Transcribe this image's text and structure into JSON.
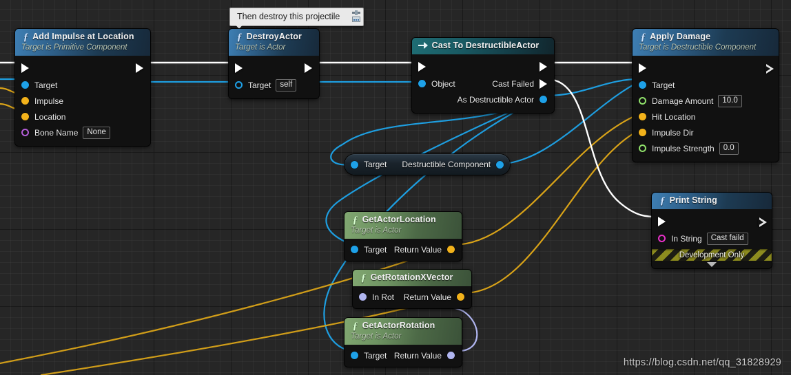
{
  "watermark": "https://blog.csdn.net/qq_31828929",
  "tooltip": {
    "text": "Then destroy this projectile"
  },
  "nodes": {
    "add_impulse": {
      "title": "Add Impulse at Location",
      "subtitle": "Target is Primitive Component",
      "pins": [
        {
          "label": "Target"
        },
        {
          "label": "Impulse"
        },
        {
          "label": "Location"
        },
        {
          "label": "Bone Name",
          "value": "None"
        }
      ]
    },
    "destroy_actor": {
      "title": "DestroyActor",
      "subtitle": "Target is Actor",
      "pins": [
        {
          "label": "Target",
          "value": "self"
        }
      ]
    },
    "cast": {
      "title": "Cast To DestructibleActor",
      "input_pin": "Object",
      "out_failed": "Cast Failed",
      "out_as": "As Destructible Actor"
    },
    "apply_damage": {
      "title": "Apply Damage",
      "subtitle": "Target is Destructible Component",
      "pins": [
        {
          "label": "Target"
        },
        {
          "label": "Damage Amount",
          "value": "10.0"
        },
        {
          "label": "Hit Location"
        },
        {
          "label": "Impulse Dir"
        },
        {
          "label": "Impulse Strength",
          "value": "0.0"
        }
      ]
    },
    "print_string": {
      "title": "Print String",
      "in_string_label": "In String",
      "in_string_value": "Cast faild",
      "dev_only": "Development Only"
    },
    "destructible_component": {
      "target_label": "Target",
      "return_label": "Destructible Component"
    },
    "get_actor_location": {
      "title": "GetActorLocation",
      "subtitle": "Target is Actor",
      "target_label": "Target",
      "return_label": "Return Value"
    },
    "get_rotation_x_vector": {
      "title": "GetRotationXVector",
      "in_label": "In Rot",
      "return_label": "Return Value"
    },
    "get_actor_rotation": {
      "title": "GetActorRotation",
      "subtitle": "Target is Actor",
      "target_label": "Target",
      "return_label": "Return Value"
    }
  },
  "colors": {
    "exec_wire": "#ffffff",
    "object_wire": "#1e9ee0",
    "vector_wire": "#d9a318",
    "object_pin": "#1ea1e8",
    "vector_pin": "#f2b21b",
    "float_pin": "#8fe06a",
    "name_pin": "#b45ed8",
    "string_pin": "#e830c8",
    "rotator_pin": "#b0b5f0"
  }
}
